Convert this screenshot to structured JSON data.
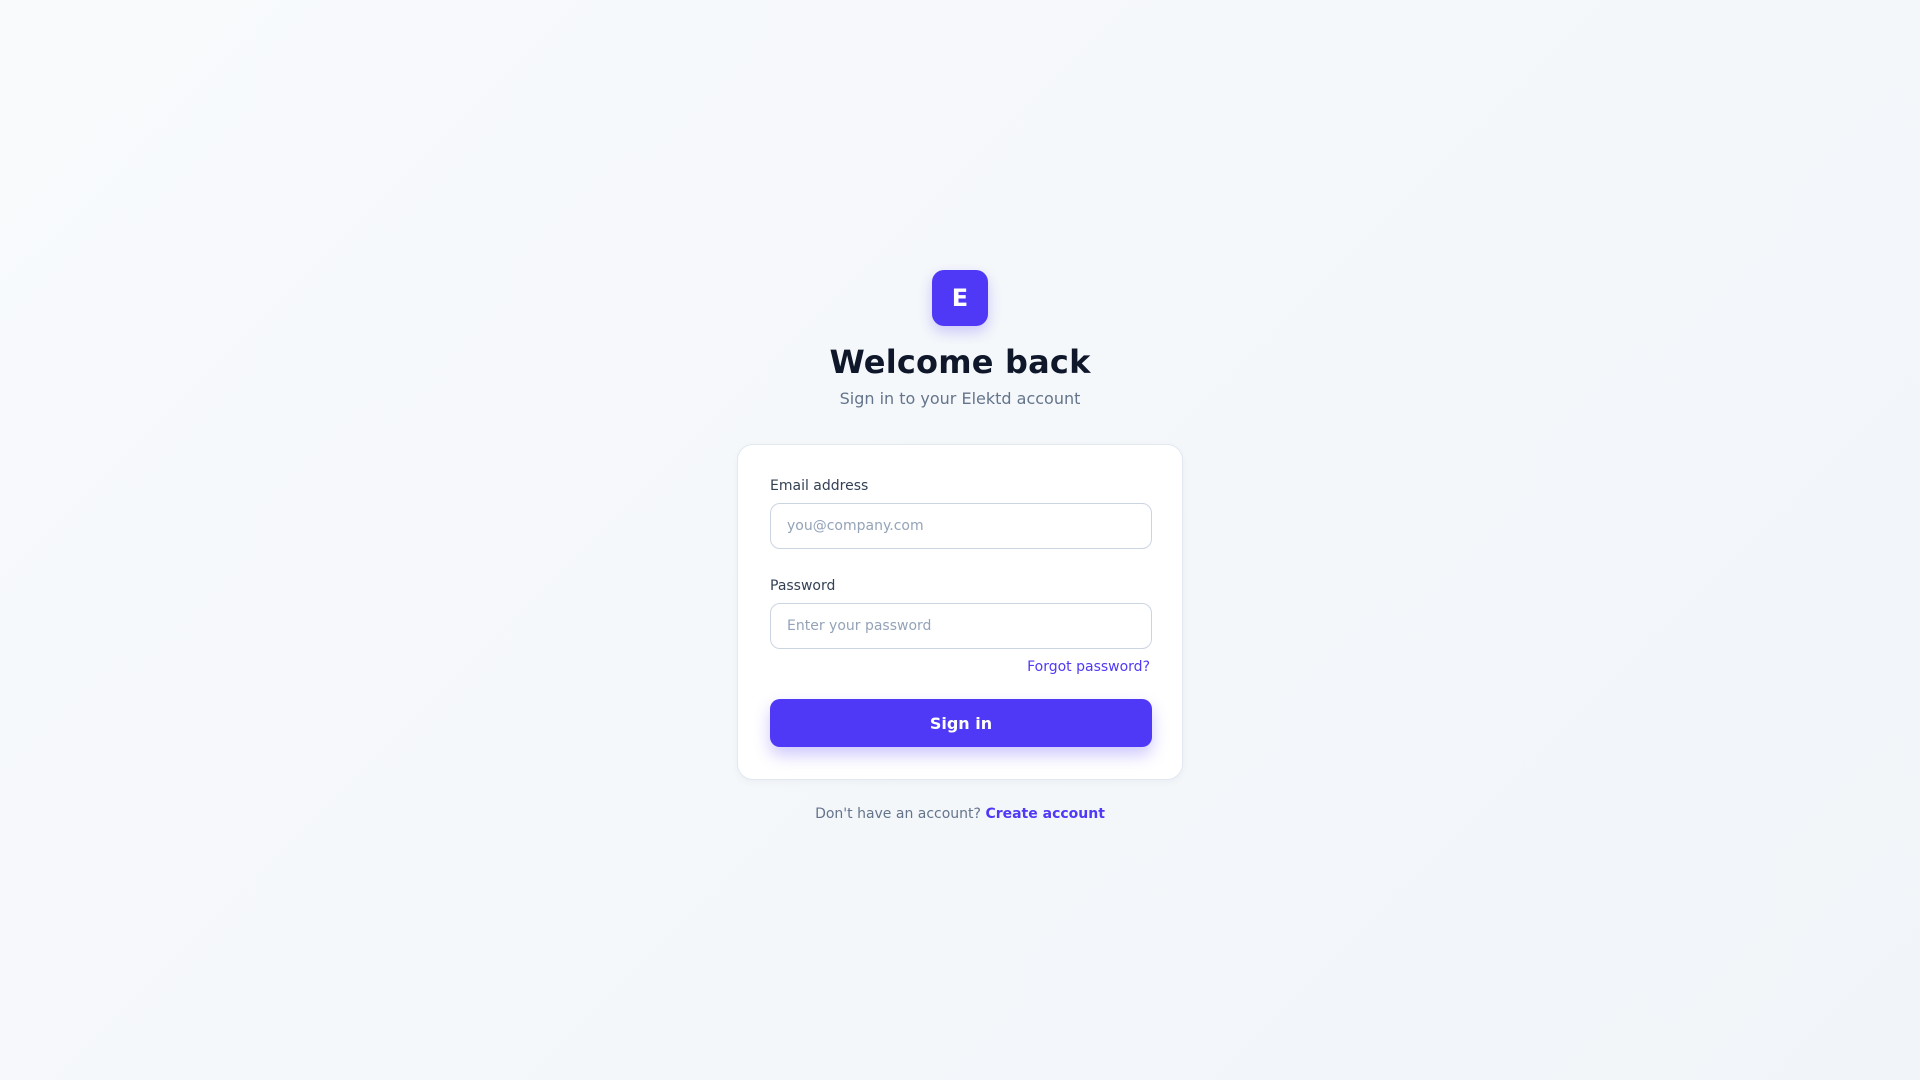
{
  "brand": {
    "logo_letter": "E",
    "accent_color": "#4f39f6"
  },
  "header": {
    "title": "Welcome back",
    "subtitle": "Sign in to your Elektd account"
  },
  "form": {
    "email": {
      "label": "Email address",
      "placeholder": "you@company.com",
      "value": ""
    },
    "password": {
      "label": "Password",
      "placeholder": "Enter your password",
      "value": ""
    },
    "forgot_label": "Forgot password?",
    "submit_label": "Sign in"
  },
  "footer": {
    "prompt": "Don't have an account?",
    "link_label": "Create account"
  }
}
